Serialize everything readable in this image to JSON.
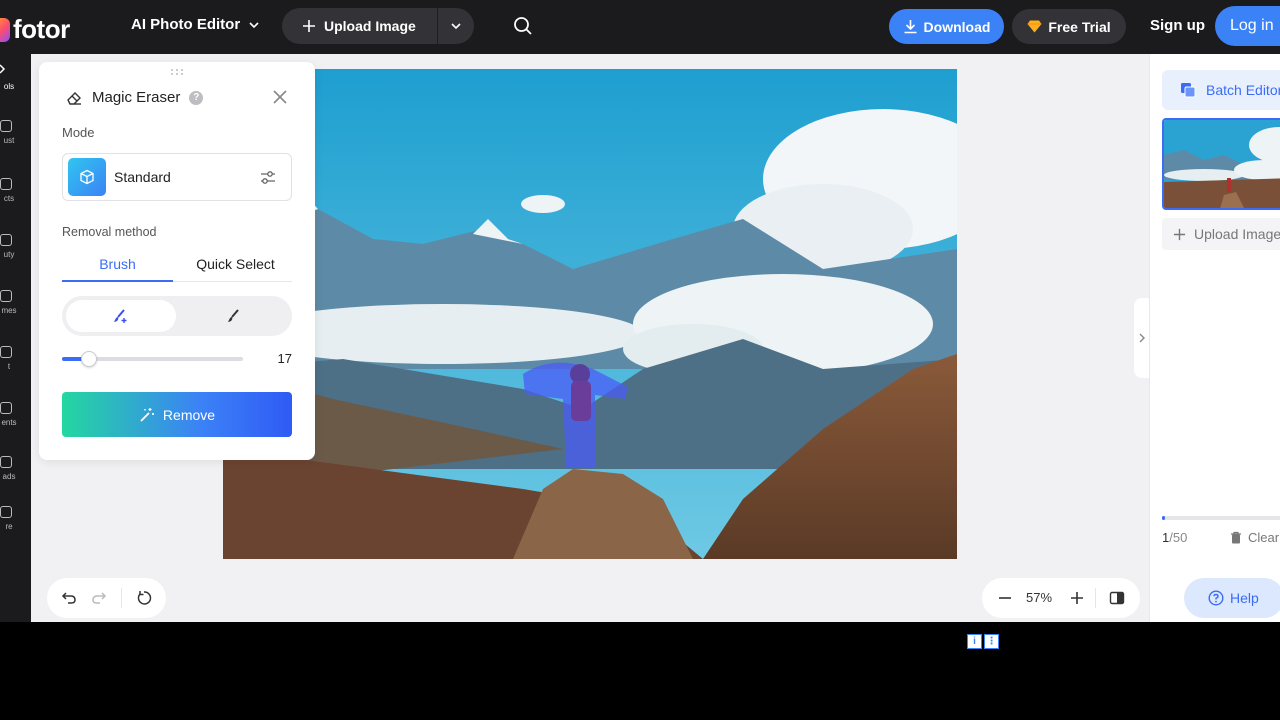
{
  "header": {
    "logo_text": "fotor",
    "editor_menu": "AI Photo Editor",
    "upload_label": "Upload Image",
    "download_label": "Download",
    "free_trial_label": "Free Trial",
    "signup_label": "Sign up",
    "login_label": "Log in"
  },
  "rail": {
    "items": [
      {
        "label": "ols",
        "icon": "tools-icon"
      },
      {
        "label": "ust",
        "icon": "adjust-icon"
      },
      {
        "label": "cts",
        "icon": "effects-icon"
      },
      {
        "label": "uty",
        "icon": "beauty-icon"
      },
      {
        "label": "mes",
        "icon": "frames-icon"
      },
      {
        "label": "t",
        "icon": "text-icon"
      },
      {
        "label": "ents",
        "icon": "elements-icon"
      },
      {
        "label": "ads",
        "icon": "uploads-icon"
      },
      {
        "label": "re",
        "icon": "more-icon"
      }
    ]
  },
  "panel": {
    "title": "Magic Eraser",
    "help": "?",
    "mode_label": "Mode",
    "mode_value": "Standard",
    "removal_method_label": "Removal method",
    "tab_brush": "Brush",
    "tab_quick_select": "Quick Select",
    "brush_size": "17",
    "brush_size_fraction": 0.15,
    "remove_label": "Remove"
  },
  "canvas": {
    "zoom": "57%"
  },
  "right_panel": {
    "batch_label": "Batch Editor",
    "upload_label": "Upload Image",
    "count_current": "1",
    "count_total": "/50",
    "clear_label": "Clear",
    "help_label": "Help"
  },
  "colors": {
    "accent": "#3b82f6",
    "dark_bar": "#1b1b1d",
    "canvas_bg": "#f1f1f3"
  }
}
